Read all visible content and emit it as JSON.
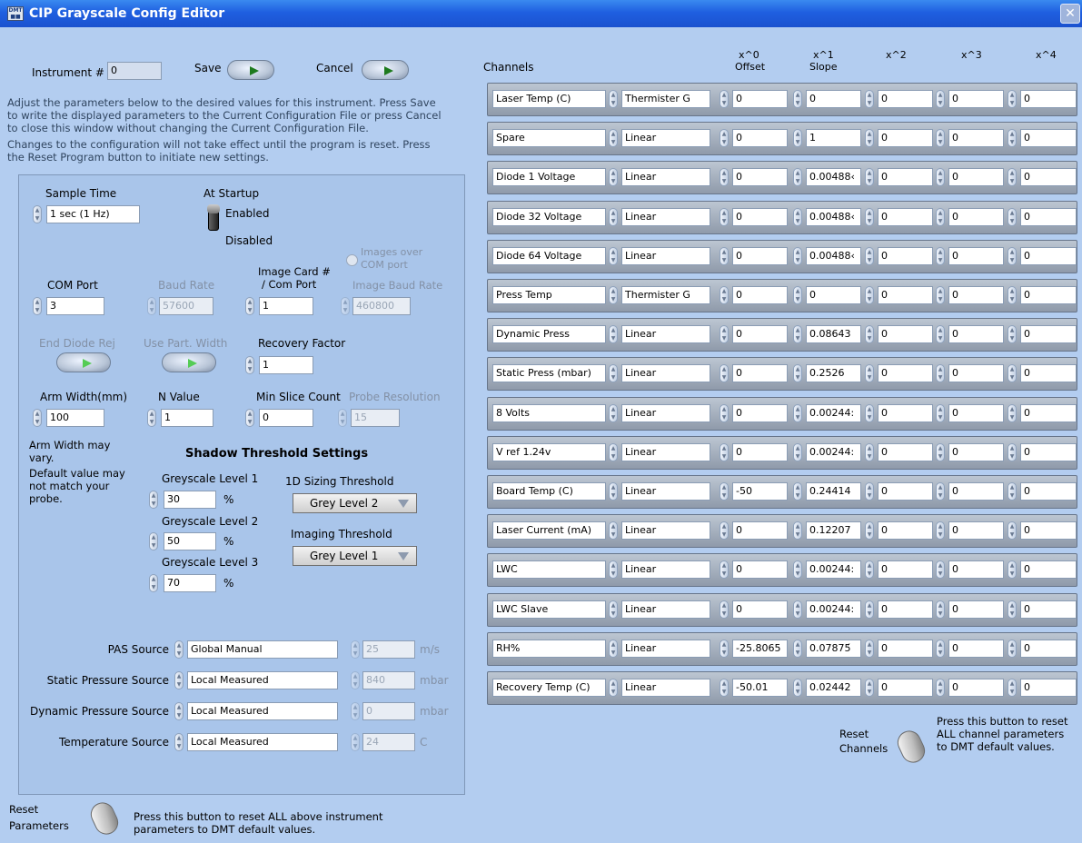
{
  "window": {
    "title": "CIP Grayscale Config Editor",
    "icon": "app-icon",
    "close_icon": "close-icon"
  },
  "left": {
    "instrument_label": "Instrument #",
    "instrument_value": "0",
    "save_label": "Save",
    "cancel_label": "Cancel",
    "instructions": [
      "Adjust the parameters below to the desired values for this instrument.  Press Save",
      "to write the displayed parameters to the Current Configuration File or press Cancel",
      "to close this window without changing the Current Configuration File.",
      "Changes to the configuration will not take effect until the program is reset.  Press",
      "the Reset Program button to initiate new settings."
    ],
    "sample_time_label": "Sample Time",
    "sample_time_value": "1 sec (1 Hz)",
    "at_startup_label": "At Startup",
    "enabled_label": "Enabled",
    "disabled_label": "Disabled",
    "images_over_com": [
      "Images over",
      "COM port"
    ],
    "image_card_label": [
      "Image Card #",
      "/ Com Port"
    ],
    "com_port_label": "COM Port",
    "com_port_value": "3",
    "baud_rate_label": "Baud Rate",
    "baud_rate_value": "57600",
    "image_card_value": "1",
    "image_baud_label": "Image Baud Rate",
    "image_baud_value": "460800",
    "end_diode_label": "End Diode Rej",
    "use_part_label": "Use Part. Width",
    "recovery_label": "Recovery Factor",
    "recovery_value": "1",
    "arm_width_label": "Arm Width(mm)",
    "arm_width_value": "100",
    "n_value_label": "N Value",
    "n_value_value": "1",
    "min_slice_label": "Min Slice Count",
    "min_slice_value": "0",
    "probe_res_label": "Probe Resolution",
    "probe_res_value": "15",
    "arm_note": [
      "Arm Width may",
      "vary.",
      "Default value may",
      "not match your",
      "probe."
    ],
    "shadow_title": "Shadow Threshold Settings",
    "grey1_label": "Greyscale Level 1",
    "grey1_value": "30",
    "grey2_label": "Greyscale Level 2",
    "grey2_value": "50",
    "grey3_label": "Greyscale Level  3",
    "grey3_value": "70",
    "percent": "%",
    "sizing_label": "1D Sizing Threshold",
    "sizing_value": "Grey Level 2",
    "imaging_label": "Imaging Threshold",
    "imaging_value": "Grey Level 1",
    "sources": [
      {
        "label": "PAS Source",
        "value": "Global Manual",
        "num": "25",
        "unit": "m/s"
      },
      {
        "label": "Static Pressure Source",
        "value": "Local Measured",
        "num": "840",
        "unit": "mbar"
      },
      {
        "label": "Dynamic Pressure Source",
        "value": "Local Measured",
        "num": "0",
        "unit": "mbar"
      },
      {
        "label": "Temperature Source",
        "value": "Local Measured",
        "num": "24",
        "unit": "C"
      }
    ],
    "reset_label": [
      "Reset",
      "Parameters"
    ],
    "reset_note": [
      "Press this button to reset ALL above instrument",
      "parameters to DMT default values."
    ]
  },
  "right": {
    "channels_label": "Channels",
    "col_headers": [
      [
        "x^0",
        "Offset"
      ],
      [
        "x^1",
        "Slope"
      ],
      [
        "x^2",
        ""
      ],
      [
        "x^3",
        ""
      ],
      [
        "x^4",
        ""
      ]
    ],
    "channels": [
      {
        "name": "Laser Temp (C)",
        "type": "Thermister G",
        "c": [
          "0",
          "0",
          "0",
          "0",
          "0"
        ]
      },
      {
        "name": "Spare",
        "type": "Linear",
        "c": [
          "0",
          "1",
          "0",
          "0",
          "0"
        ]
      },
      {
        "name": "Diode 1 Voltage",
        "type": "Linear",
        "c": [
          "0",
          "0.00488‹",
          "0",
          "0",
          "0"
        ]
      },
      {
        "name": "Diode 32 Voltage",
        "type": "Linear",
        "c": [
          "0",
          "0.00488‹",
          "0",
          "0",
          "0"
        ]
      },
      {
        "name": "Diode 64 Voltage",
        "type": "Linear",
        "c": [
          "0",
          "0.00488‹",
          "0",
          "0",
          "0"
        ]
      },
      {
        "name": "Press Temp",
        "type": "Thermister G",
        "c": [
          "0",
          "0",
          "0",
          "0",
          "0"
        ]
      },
      {
        "name": "Dynamic Press",
        "type": "Linear",
        "c": [
          "0",
          "0.08643",
          "0",
          "0",
          "0"
        ]
      },
      {
        "name": "Static Press (mbar)",
        "type": "Linear",
        "c": [
          "0",
          "0.2526",
          "0",
          "0",
          "0"
        ]
      },
      {
        "name": "8 Volts",
        "type": "Linear",
        "c": [
          "0",
          "0.00244:",
          "0",
          "0",
          "0"
        ]
      },
      {
        "name": "V ref 1.24v",
        "type": "Linear",
        "c": [
          "0",
          "0.00244:",
          "0",
          "0",
          "0"
        ]
      },
      {
        "name": "Board Temp (C)",
        "type": "Linear",
        "c": [
          "-50",
          "0.24414",
          "0",
          "0",
          "0"
        ]
      },
      {
        "name": "Laser Current (mA)",
        "type": "Linear",
        "c": [
          "0",
          "0.12207",
          "0",
          "0",
          "0"
        ]
      },
      {
        "name": "LWC",
        "type": "Linear",
        "c": [
          "0",
          "0.00244:",
          "0",
          "0",
          "0"
        ]
      },
      {
        "name": "LWC Slave",
        "type": "Linear",
        "c": [
          "0",
          "0.00244:",
          "0",
          "0",
          "0"
        ]
      },
      {
        "name": "RH%",
        "type": "Linear",
        "c": [
          "-25.8065",
          "0.07875́",
          "0",
          "0",
          "0"
        ]
      },
      {
        "name": "Recovery Temp (C)",
        "type": "Linear",
        "c": [
          "-50.01",
          "0.02442",
          "0",
          "0",
          "0"
        ]
      }
    ],
    "reset_label": [
      "Reset",
      "Channels"
    ],
    "reset_note": [
      "Press this button to reset",
      "ALL channel parameters",
      "to DMT default values."
    ]
  }
}
